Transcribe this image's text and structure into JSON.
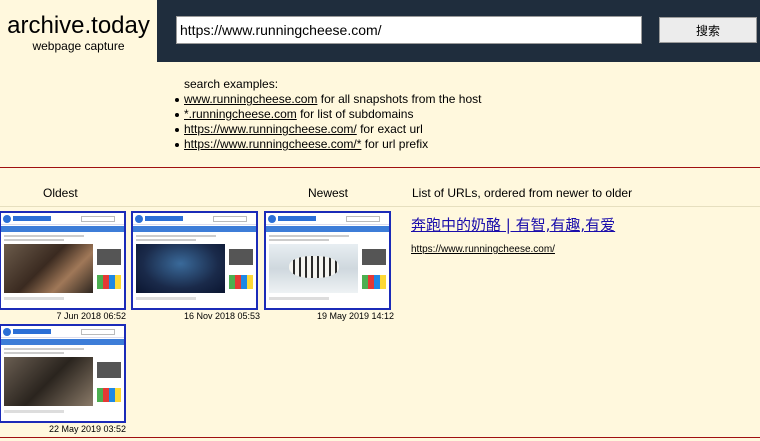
{
  "header": {
    "brand_title": "archive.today",
    "brand_subtitle": "webpage capture",
    "url_value": "https://www.runningcheese.com/",
    "search_button": "搜索"
  },
  "examples": {
    "heading": "search examples:",
    "items": [
      {
        "link": "www.runningcheese.com",
        "text": " for all snapshots from the host"
      },
      {
        "link": "*.runningcheese.com",
        "text": " for list of subdomains"
      },
      {
        "link": "https://www.runningcheese.com/",
        "text": " for exact url"
      },
      {
        "link": "https://www.runningcheese.com/*",
        "text": " for url prefix"
      }
    ]
  },
  "columns": {
    "oldest": "Oldest",
    "newest": "Newest",
    "list": "List of URLs, ordered from newer to older"
  },
  "snapshots": [
    {
      "date": "7 Jun 2018 06:52"
    },
    {
      "date": "16 Nov 2018 05:53"
    },
    {
      "date": "19 May 2019 14:12"
    },
    {
      "date": "22 May 2019 03:52"
    }
  ],
  "result": {
    "title": "奔跑中的奶酪 | 有智,有趣,有爱",
    "url": "https://www.runningcheese.com/"
  },
  "colors": {
    "background": "#fff8dd",
    "header_bar": "#1f2d3d",
    "separator": "#a01010",
    "thumb_border": "#1b2bb8",
    "link": "#1a0dab"
  }
}
